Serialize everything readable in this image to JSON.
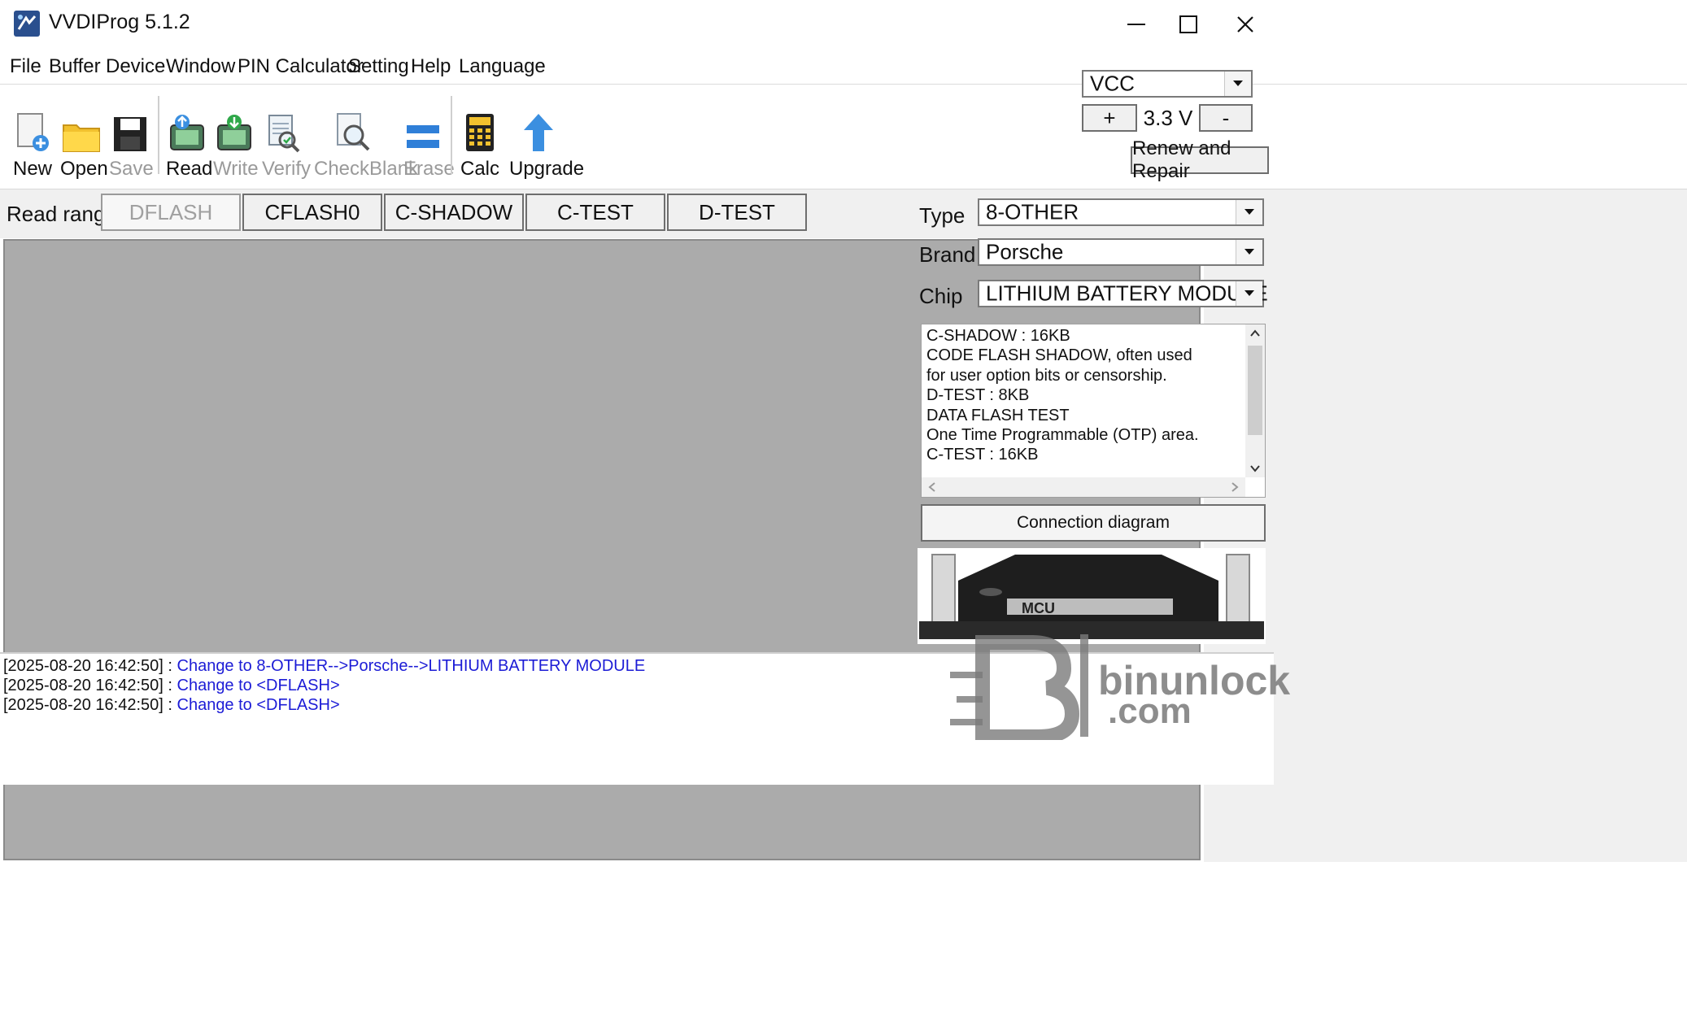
{
  "window": {
    "title": "VVDIProg 5.1.2",
    "minimize_glyph": "—",
    "maximize_glyph": "☐",
    "close_glyph": "✕"
  },
  "menu": [
    "File",
    "Buffer",
    "Device",
    "Window",
    "PIN Calculator",
    "Setting",
    "Help",
    "Language"
  ],
  "toolbar": {
    "new": "New",
    "open": "Open",
    "save": "Save",
    "read": "Read",
    "write": "Write",
    "verify": "Verify",
    "checkblank": "CheckBlank",
    "erase": "Erase",
    "calc": "Calc",
    "upgrade": "Upgrade"
  },
  "power": {
    "select": "VCC",
    "plus": "+",
    "voltage": "3.3 V",
    "minus": "-"
  },
  "read_range": {
    "label": "Read range",
    "tabs": [
      "DFLASH",
      "CFLASH0",
      "C-SHADOW",
      "C-TEST",
      "D-TEST"
    ],
    "active": "DFLASH"
  },
  "renew_button": "Renew and Repair",
  "selection": {
    "type_label": "Type",
    "type_value": "8-OTHER",
    "brand_label": "Brand",
    "brand_value": "Porsche",
    "chip_label": "Chip",
    "chip_value": "LITHIUM BATTERY MODULE"
  },
  "info_lines": [
    "C-SHADOW : 16KB",
    "CODE FLASH SHADOW, often used",
    "for user option bits or censorship.",
    "D-TEST : 8KB",
    "DATA FLASH TEST",
    "One Time Programmable (OTP) area.",
    "C-TEST : 16KB"
  ],
  "connection_button": "Connection diagram",
  "mcu_label": "MCU",
  "log": [
    {
      "ts": "[2025-08-20 16:42:50] : ",
      "msg": "Change to 8-OTHER-->Porsche-->LITHIUM BATTERY MODULE"
    },
    {
      "ts": "[2025-08-20 16:42:50] : ",
      "msg": "Change to <DFLASH>"
    },
    {
      "ts": "[2025-08-20 16:42:50] : ",
      "msg": "Change to <DFLASH>"
    }
  ],
  "watermark": {
    "line1": "binunlock",
    "line2": ".com"
  },
  "colors": {
    "log_message": "#1c1cd6",
    "hex_area": "#ababab",
    "panel": "#f0f0f0"
  }
}
